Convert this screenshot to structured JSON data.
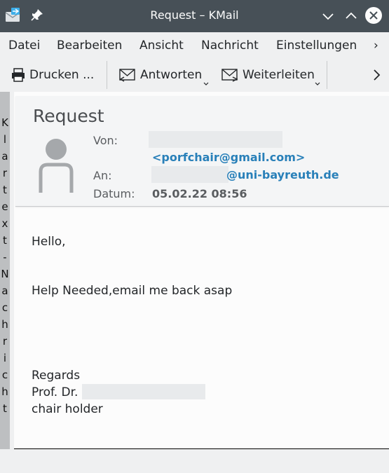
{
  "window": {
    "title": "Request – KMail"
  },
  "menu": [
    "Datei",
    "Bearbeiten",
    "Ansicht",
    "Nachricht",
    "Einstellungen",
    "›"
  ],
  "toolbar": {
    "print_label": "Drucken ...",
    "reply_label": "Antworten",
    "forward_label": "Weiterleiten",
    "more_label": "›"
  },
  "sidebar": {
    "label_chars": [
      "K",
      "l",
      "a",
      "r",
      "t",
      "e",
      "x",
      "t",
      "-",
      "N",
      "a",
      "c",
      "h",
      "r",
      "i",
      "c",
      "h",
      "t"
    ]
  },
  "message": {
    "subject": "Request",
    "from_label": "Von:",
    "from_email": "<porfchair@gmail.com>",
    "to_label": "An:",
    "to_domain": "@uni-bayreuth.de",
    "date_label": "Datum:",
    "date_value": "05.02.22 08:56",
    "body": {
      "greeting": "Hello,",
      "line1": "Help Needed,email me back asap",
      "regards": "Regards",
      "signature_title": "Prof. Dr.",
      "signature_role": "chair holder"
    }
  }
}
